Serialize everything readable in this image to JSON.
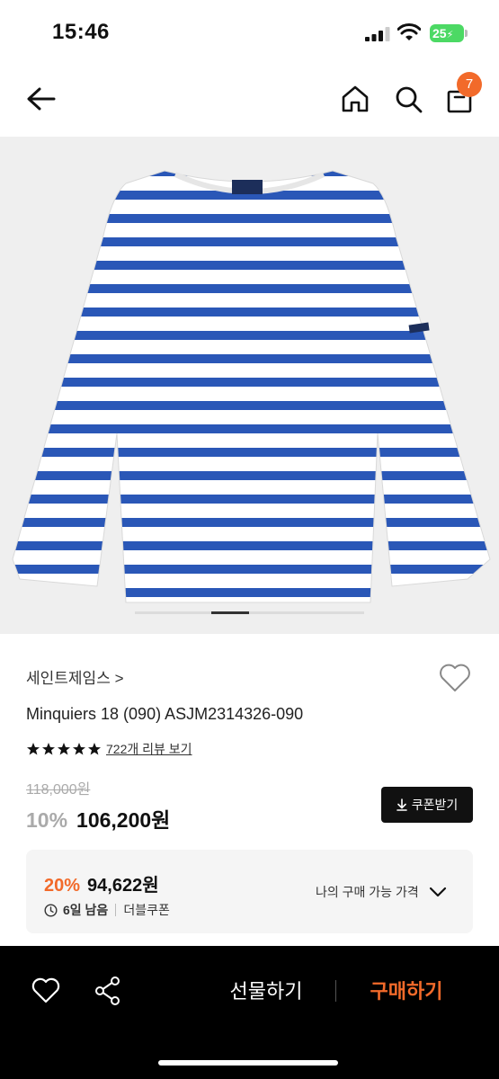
{
  "status_bar": {
    "time": "15:46",
    "battery": "25"
  },
  "header": {
    "cart_count": "7",
    "icons": [
      "arrow-left-icon",
      "home-icon",
      "search-icon",
      "shopping-bag-icon"
    ]
  },
  "product": {
    "image_description_colors": {
      "stripe": "#2a57b7",
      "base": "#ffffff"
    },
    "brand": "세인트제임스 >",
    "name": "Minquiers 18 (090) ASJM2314326-090",
    "rating_stars": 5,
    "review_link": "722개 리뷰 보기",
    "original_price": "118,000원",
    "discount_rate": "10%",
    "sale_price": "106,200원",
    "coupon_button": "쿠폰받기"
  },
  "promo": {
    "rate": "20%",
    "price": "94,622원",
    "days_left": "6일 남음",
    "coupon_type": "더블쿠폰",
    "my_price_link": "나의 구매 가능 가격"
  },
  "bottom_bar": {
    "gift_label": "선물하기",
    "buy_label": "구매하기"
  },
  "colors": {
    "accent": "#f26a2a",
    "dark": "#111111",
    "muted": "#aaaaaa"
  }
}
